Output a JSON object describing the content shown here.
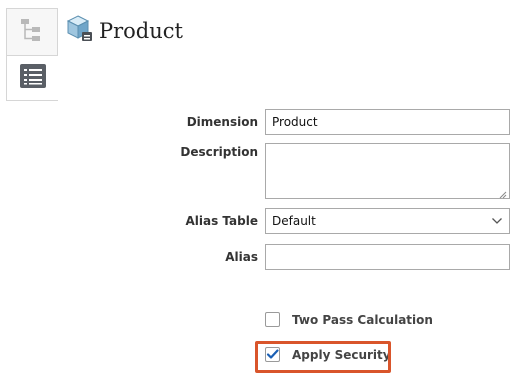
{
  "header": {
    "title": "Product",
    "icon": "dimension-cube-icon"
  },
  "tabs": [
    {
      "name": "hierarchy",
      "icon": "hierarchy-tree-icon"
    },
    {
      "name": "properties",
      "icon": "properties-list-icon",
      "selected": true
    }
  ],
  "form": {
    "dimension_label": "Dimension",
    "dimension_value": "Product",
    "description_label": "Description",
    "description_value": "",
    "alias_table_label": "Alias Table",
    "alias_table_value": "Default",
    "alias_label": "Alias",
    "alias_value": ""
  },
  "options": {
    "two_pass_label": "Two Pass Calculation",
    "two_pass_checked": false,
    "apply_security_label": "Apply Security",
    "apply_security_checked": true
  },
  "colors": {
    "highlight": "#d9552b",
    "check": "#1a5fb4"
  }
}
